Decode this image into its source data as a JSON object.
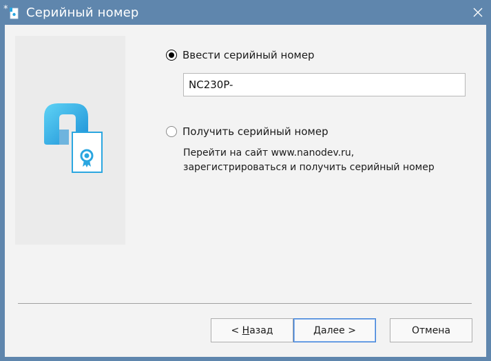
{
  "window": {
    "title": "Серийный номер"
  },
  "options": {
    "enter": {
      "label": "Ввести серийный номер",
      "checked": true
    },
    "get": {
      "label": "Получить серийный номер",
      "checked": false,
      "description_line1": "Перейти на сайт www.nanodev.ru,",
      "description_line2": "зарегистрироваться и получить серийный номер"
    }
  },
  "serial_input": {
    "value": "NC230P-"
  },
  "buttons": {
    "back": {
      "prefix": "< ",
      "mnemonic": "Н",
      "rest": "азад"
    },
    "next": {
      "mnemonic": "Д",
      "rest": "алее >"
    },
    "cancel": {
      "label": "Отмена"
    }
  },
  "icons": {
    "title": "app-certificate-icon",
    "close": "close-icon",
    "logo": "nanocad-certificate-icon"
  },
  "colors": {
    "titlebar": "#5f86ad",
    "accent": "#3c7fd8",
    "logo_blue": "#2aa6e0"
  }
}
